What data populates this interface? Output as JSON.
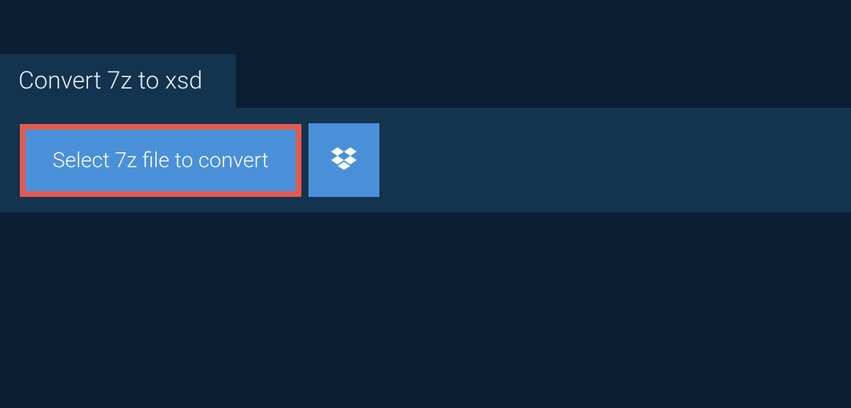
{
  "tab": {
    "label": "Convert 7z to xsd"
  },
  "actions": {
    "select_label": "Select 7z file to convert",
    "dropbox_icon": "dropbox-icon"
  }
}
